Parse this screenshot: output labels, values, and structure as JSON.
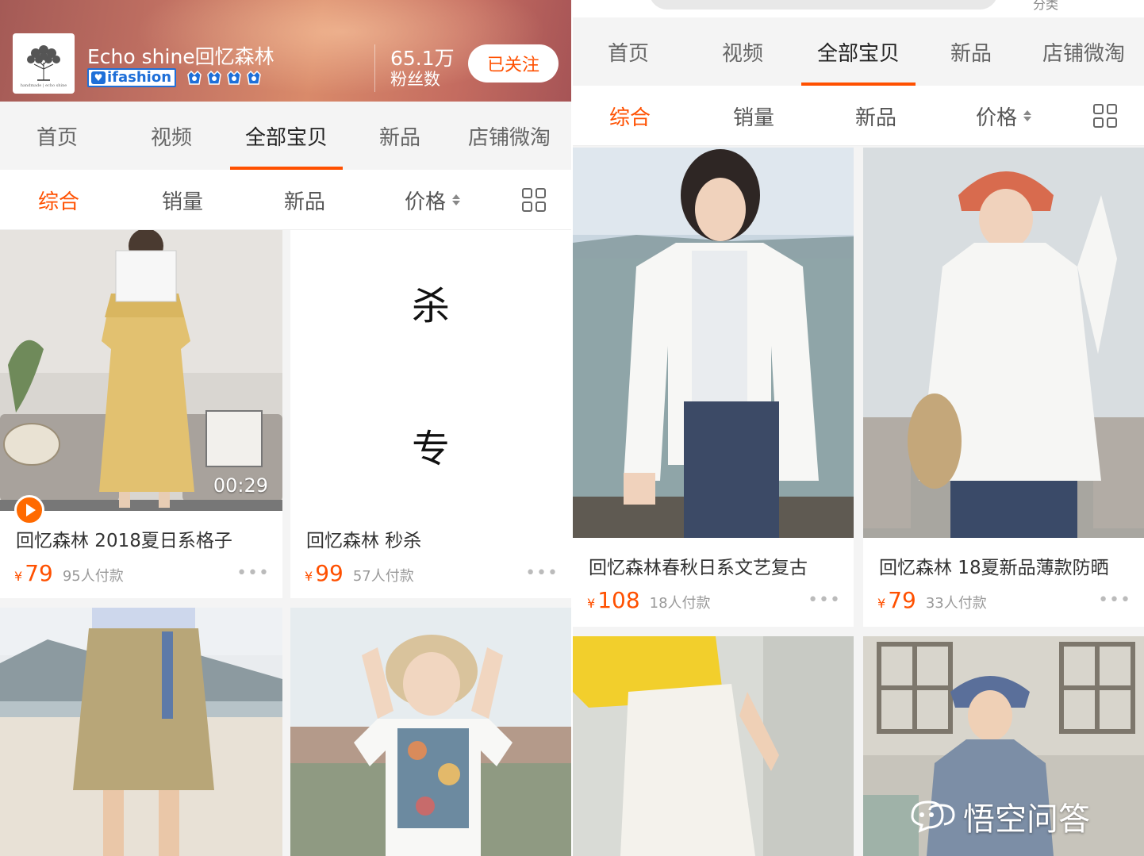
{
  "shop": {
    "name": "Echo shine回忆森林",
    "badge": "ifashion",
    "fans_count": "65.1万",
    "fans_label": "粉丝数",
    "follow_label": "已关注",
    "logo_caption": "handmade | echo shine"
  },
  "tabs": [
    "首页",
    "视频",
    "全部宝贝",
    "新品",
    "店铺微淘"
  ],
  "active_tab": "全部宝贝",
  "sort_options": [
    "综合",
    "销量",
    "新品",
    "价格"
  ],
  "active_sort": "综合",
  "left_products": [
    {
      "title": "回忆森林  2018夏日系格子",
      "currency": "¥",
      "price": "79",
      "sales": "95人付款",
      "video_duration": "00:29"
    },
    {
      "title": "回忆森林 秒杀",
      "currency": "¥",
      "price": "99",
      "sales": "57人付款",
      "big_text_1": "杀",
      "big_text_2": "专"
    }
  ],
  "right_products": [
    {
      "title": "回忆森林春秋日系文艺复古",
      "currency": "¥",
      "price": "108",
      "sales": "18人付款"
    },
    {
      "title": "回忆森林 18夏新品薄款防晒",
      "currency": "¥",
      "price": "79",
      "sales": "33人付款"
    }
  ],
  "more_label": "•••",
  "right_header_remnant": "分类",
  "watermark": "悟空问答",
  "colors": {
    "accent": "#ff5000",
    "background": "#f4f4f4",
    "ifashion_blue": "#1e6fd8"
  }
}
